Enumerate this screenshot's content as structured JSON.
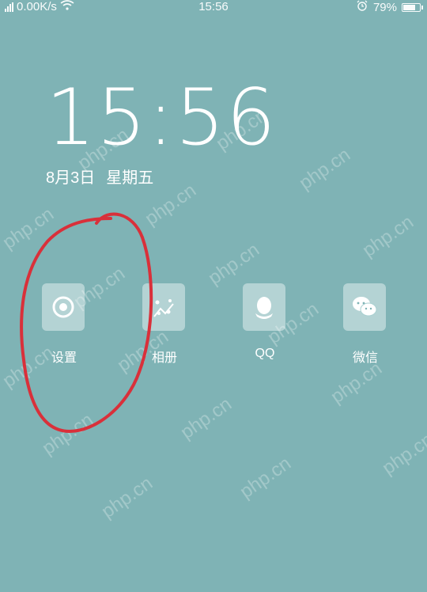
{
  "status_bar": {
    "network_speed": "0.00K/s",
    "time": "15:56",
    "battery": "79%",
    "battery_level": 0.79,
    "icons": [
      "signal-icon",
      "wifi-icon",
      "alarm-icon",
      "battery-icon"
    ]
  },
  "lockscreen": {
    "clock": "15:56",
    "date": "8月3日",
    "weekday": "星期五"
  },
  "apps": [
    {
      "label": "设置",
      "icon": "settings-icon"
    },
    {
      "label": "相册",
      "icon": "album-icon"
    },
    {
      "label": "QQ",
      "icon": "qq-icon"
    },
    {
      "label": "微信",
      "icon": "wechat-icon"
    }
  ],
  "watermark": "php.cn",
  "annotation_color": "#d9303a",
  "background_color": "#7fb3b5"
}
